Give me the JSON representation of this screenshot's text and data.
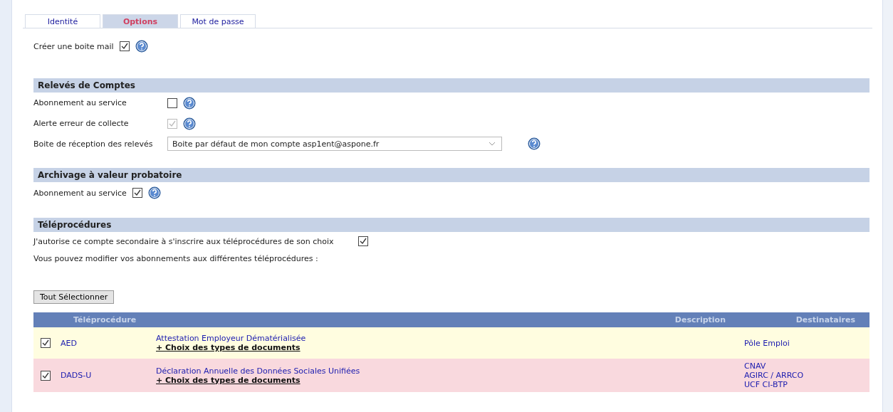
{
  "tabs": [
    {
      "label": "Identité",
      "selected": false
    },
    {
      "label": "Options",
      "selected": true
    },
    {
      "label": "Mot de passe",
      "selected": false
    }
  ],
  "mailbox": {
    "label": "Créer une boite mail",
    "checked": true
  },
  "sections": [
    {
      "title": "Relevés de Comptes",
      "rows": [
        {
          "kind": "checkbox",
          "label": "Abonnement au service",
          "checked": false,
          "disabled": false
        },
        {
          "kind": "checkbox",
          "label": "Alerte erreur de collecte",
          "checked": true,
          "disabled": true
        },
        {
          "kind": "select",
          "label": "Boite de réception des relevés",
          "value": "Boite par défaut de mon compte asp1ent@aspone.fr"
        }
      ]
    },
    {
      "title": "Archivage à valeur probatoire",
      "rows": [
        {
          "kind": "checkbox",
          "label": "Abonnement au service",
          "checked": true,
          "disabled": false
        }
      ]
    },
    {
      "title": "Téléprocédures"
    }
  ],
  "teleprocedures": {
    "authorize": {
      "label": "J'autorise ce compte secondaire à s'inscrire aux téléprocédures de son choix",
      "checked": true
    },
    "note": "Vous pouvez modifier vos abonnements aux différentes téléprocédures :",
    "select_all": "Tout Sélectionner",
    "table": {
      "columns": [
        "Téléprocédure",
        "Description",
        "Destinataires"
      ],
      "rows": [
        {
          "checked": true,
          "code": "AED",
          "description": "Attestation Employeur Dématérialisée",
          "link": "+ Choix des types de documents",
          "recipients": [
            "Pôle Emploi"
          ],
          "color": "#fffde0"
        },
        {
          "checked": true,
          "code": "DADS-U",
          "description": "Déclaration Annuelle des Données Sociales Unifiées",
          "link": "+ Choix des types de documents",
          "recipients": [
            "CNAV",
            "AGIRC / ARRCO",
            "UCF CI-BTP"
          ],
          "color": "#f9d9de"
        }
      ]
    }
  }
}
